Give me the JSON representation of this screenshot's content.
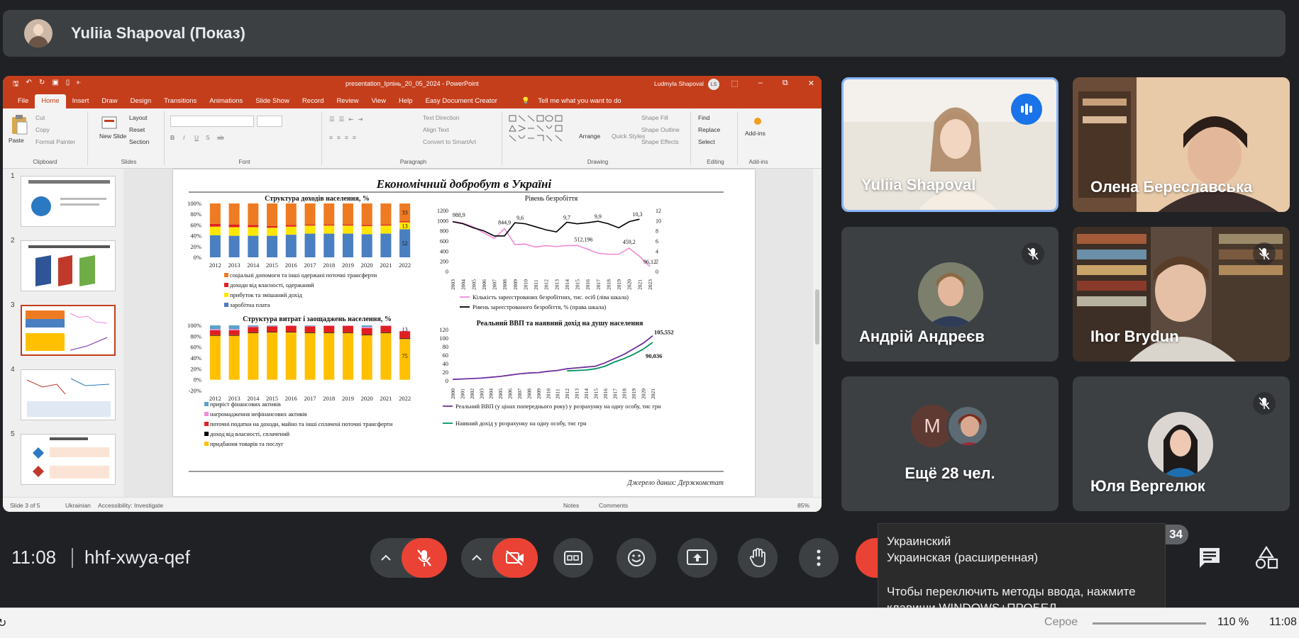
{
  "presenter": {
    "name": "Yuliia Shapoval (Показ)"
  },
  "powerpoint": {
    "title": "presentation_Ірпінь_20_05_2024  -  PowerPoint",
    "user": "Ludmyla Shapoval",
    "user_initials": "LS",
    "menu": [
      "File",
      "Home",
      "Insert",
      "Draw",
      "Design",
      "Transitions",
      "Animations",
      "Slide Show",
      "Record",
      "Review",
      "View",
      "Help",
      "Easy Document Creator"
    ],
    "tell_me": "Tell me what you want to do",
    "ribbon": {
      "clipboard": {
        "paste": "Paste",
        "cut": "Cut",
        "copy": "Copy",
        "format_painter": "Format Painter",
        "label": "Clipboard"
      },
      "slides": {
        "new_slide": "New Slide",
        "layout": "Layout",
        "reset": "Reset",
        "section": "Section",
        "label": "Slides"
      },
      "font": {
        "label": "Font"
      },
      "paragraph": {
        "text_direction": "Text Direction",
        "align_text": "Align Text",
        "convert": "Convert to SmartArt",
        "label": "Paragraph"
      },
      "drawing": {
        "arrange": "Arrange",
        "quick_styles": "Quick Styles",
        "shape_fill": "Shape Fill",
        "shape_outline": "Shape Outline",
        "shape_effects": "Shape Effects",
        "label": "Drawing"
      },
      "editing": {
        "find": "Find",
        "replace": "Replace",
        "select": "Select",
        "label": "Editing"
      },
      "addins": {
        "addins": "Add-ins",
        "label": "Add-ins"
      }
    },
    "thumb_numbers": [
      "1",
      "2",
      "3",
      "4",
      "5"
    ],
    "status": {
      "slide": "Slide 3 of 5",
      "language": "Ukrainian",
      "accessibility": "Accessibility: Investigate",
      "notes": "Notes",
      "comments": "Comments",
      "zoom": "85%"
    }
  },
  "slide": {
    "title": "Економічний добробут в Україні",
    "source": "Джерело даних: Держкомстат"
  },
  "chart_data": [
    {
      "type": "bar",
      "title": "Структура доходів населення, %",
      "categories": [
        "2012",
        "2013",
        "2014",
        "2015",
        "2016",
        "2017",
        "2018",
        "2019",
        "2020",
        "2021",
        "2022"
      ],
      "ylim": [
        0,
        100
      ],
      "yticks": [
        "0%",
        "20%",
        "40%",
        "60%",
        "80%",
        "100%"
      ],
      "series": [
        {
          "name": "заробітна плата",
          "color": "#4a7fc1",
          "values": [
            41,
            40,
            40,
            40,
            42,
            44,
            44,
            44,
            43,
            44,
            52
          ]
        },
        {
          "name": "прибуток та змішаний дохід",
          "color": "#ffe600",
          "values": [
            16,
            16,
            16,
            15,
            15,
            15,
            15,
            15,
            15,
            15,
            13
          ]
        },
        {
          "name": "доходи від власності, одержаний",
          "color": "#e02020",
          "values": [
            5,
            5,
            4,
            3,
            3,
            2,
            2,
            2,
            2,
            2,
            2
          ]
        },
        {
          "name": "соціальні допомоги та інші одержані поточні трансферти",
          "color": "#ee7b22",
          "values": [
            38,
            39,
            40,
            42,
            40,
            39,
            39,
            39,
            40,
            39,
            33
          ]
        }
      ],
      "data_labels": [
        "52",
        "13",
        "33"
      ]
    },
    {
      "type": "line",
      "title": "Рівень безробіття",
      "x": [
        "2003",
        "2004",
        "2005",
        "2006",
        "2007",
        "2008",
        "2009",
        "2010",
        "2011",
        "2012",
        "2013",
        "2014",
        "2015",
        "2016",
        "2017",
        "2018",
        "2019",
        "2020",
        "2021",
        "2023"
      ],
      "ylim_left": [
        0,
        1200
      ],
      "ylim_right": [
        0,
        12
      ],
      "yticks_left": [
        "0",
        "200",
        "400",
        "600",
        "800",
        "1000",
        "1200"
      ],
      "yticks_right": [
        "0",
        "2",
        "4",
        "6",
        "8",
        "10",
        "12"
      ],
      "series": [
        {
          "name": "Кількість зареєстрованих безробітних, тис. осіб (ліва шкала)",
          "color": "#f08ad7",
          "values": [
            988.9,
            950,
            880,
            760,
            650,
            844.9,
            530,
            540,
            480,
            510,
            490,
            510,
            512.196,
            440,
            360,
            340,
            340,
            459.2,
            300,
            96.12
          ]
        },
        {
          "name": "Рівень зареєстрованого безробіття, % (права шкала)",
          "color": "#000000",
          "values": [
            9.8,
            9.4,
            8.6,
            8.0,
            7.0,
            7.0,
            9.6,
            9.4,
            8.8,
            8.2,
            7.8,
            9.7,
            9.4,
            9.6,
            9.9,
            9.4,
            8.6,
            9.8,
            10.3,
            null
          ]
        }
      ],
      "data_labels": [
        "988,9",
        "844,9",
        "9,6",
        "9,7",
        "9,9",
        "10,3",
        "512,196",
        "459,2",
        "96,12"
      ]
    },
    {
      "type": "bar",
      "title": "Структура витрат і заощаджень населення, %",
      "categories": [
        "2012",
        "2013",
        "2014",
        "2015",
        "2016",
        "2017",
        "2018",
        "2019",
        "2020",
        "2021",
        "2022"
      ],
      "ylim": [
        -20,
        100
      ],
      "yticks": [
        "-20%",
        "0%",
        "20%",
        "40%",
        "60%",
        "80%",
        "100%"
      ],
      "series": [
        {
          "name": "придбання товарів та послуг",
          "color": "#ffc000",
          "values": [
            81,
            81,
            86,
            87,
            87,
            86,
            86,
            86,
            82,
            86,
            75
          ]
        },
        {
          "name": "доход від власності, сплачений",
          "color": "#000000",
          "values": [
            1,
            1,
            1,
            1,
            1,
            1,
            1,
            1,
            1,
            1,
            1
          ]
        },
        {
          "name": "поточні податки на доходи, майно та інші сплачені поточні трансферти",
          "color": "#e02020",
          "values": [
            9,
            9,
            10,
            10,
            11,
            11,
            12,
            12,
            12,
            12,
            13
          ]
        },
        {
          "name": "нагромадження нефінансових активів",
          "color": "#f08ad7",
          "values": [
            2,
            2,
            1,
            1,
            1,
            1,
            1,
            1,
            2,
            1,
            1
          ]
        },
        {
          "name": "приріст фінансових активів",
          "color": "#5ba3c9",
          "values": [
            7,
            7,
            2,
            1,
            0,
            1,
            0,
            0,
            3,
            0,
            0
          ]
        }
      ],
      "data_labels": [
        "75",
        "13"
      ]
    },
    {
      "type": "line",
      "title": "Реальний ВВП та наявний дохід на душу населення",
      "x": [
        "2000",
        "2001",
        "2002",
        "2003",
        "2004",
        "2005",
        "2006",
        "2007",
        "2008",
        "2009",
        "2010",
        "2011",
        "2012",
        "2013",
        "2014",
        "2015",
        "2016",
        "2017",
        "2018",
        "2019",
        "2020",
        "2021"
      ],
      "ylim": [
        0,
        120
      ],
      "yticks": [
        "0",
        "20",
        "40",
        "60",
        "80",
        "100",
        "120"
      ],
      "series": [
        {
          "name": "Реальний ВВП (у цінах попереднього року) у розрахунку на одну особу, тис грн",
          "color": "#7030a0",
          "values": [
            3,
            4,
            5,
            6,
            8,
            10,
            13,
            16,
            18,
            19,
            22,
            24,
            28,
            30,
            32,
            34,
            42,
            52,
            62,
            75,
            88,
            105.552
          ]
        },
        {
          "name": "Наявний дохід у розрахунку на одну особу, тис грн",
          "color": "#00945e",
          "values": [
            null,
            null,
            null,
            null,
            null,
            null,
            null,
            null,
            null,
            null,
            null,
            null,
            23,
            24,
            25,
            28,
            34,
            44,
            52,
            62,
            74,
            90.036
          ]
        }
      ],
      "data_labels": [
        "105,552",
        "90,036"
      ]
    }
  ],
  "participants": [
    {
      "name": "Yuliia Shapoval"
    },
    {
      "name": "Олена Береславська"
    },
    {
      "name": "Андрій Андреєв"
    },
    {
      "name": "Ihor Brydun"
    },
    {
      "name": "Ещё 28 чел.",
      "initial": "M"
    },
    {
      "name": "Юля Вергелюк"
    }
  ],
  "meeting": {
    "time": "11:08",
    "code": "hhf-xwya-qef",
    "participant_count": "34"
  },
  "tooltip": {
    "line1": "Украинский",
    "line2": "Украинская (расширенная)",
    "line3": "Чтобы переключить методы ввода, нажмите",
    "line4": "клавиши WINDOWS+ПРОБЕЛ."
  },
  "taskbar": {
    "zoom": "110 %",
    "time": "11:08",
    "label": "Серое"
  }
}
